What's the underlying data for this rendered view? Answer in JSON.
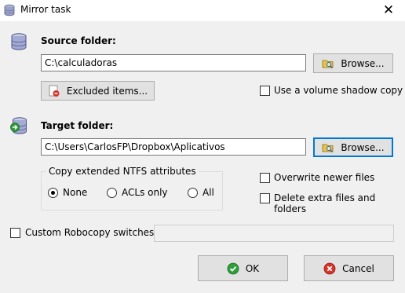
{
  "window": {
    "title": "Mirror task",
    "close_glyph": "✕"
  },
  "source": {
    "label": "Source folder:",
    "path": "C:\\calculadoras",
    "browse_label": "Browse...",
    "excluded_label": "Excluded items...",
    "shadow_copy_label": "Use a volume shadow copy",
    "shadow_copy_checked": false
  },
  "target": {
    "label": "Target folder:",
    "path": "C:\\Users\\CarlosFP\\Dropbox\\Aplicativos",
    "browse_label": "Browse..."
  },
  "ntfs": {
    "legend": "Copy extended NTFS attributes",
    "options": [
      "None",
      "ACLs only",
      "All"
    ],
    "selected": "None"
  },
  "options": {
    "overwrite_label": "Overwrite newer files",
    "overwrite_checked": false,
    "delete_label": "Delete extra files and folders",
    "delete_checked": false
  },
  "robocopy": {
    "label": "Custom Robocopy switches:",
    "checked": false,
    "value": ""
  },
  "footer": {
    "ok_label": "OK",
    "cancel_label": "Cancel"
  },
  "colors": {
    "accent": "#0078d7",
    "ok_green": "#2e9e3a",
    "cancel_red": "#d8322a"
  }
}
